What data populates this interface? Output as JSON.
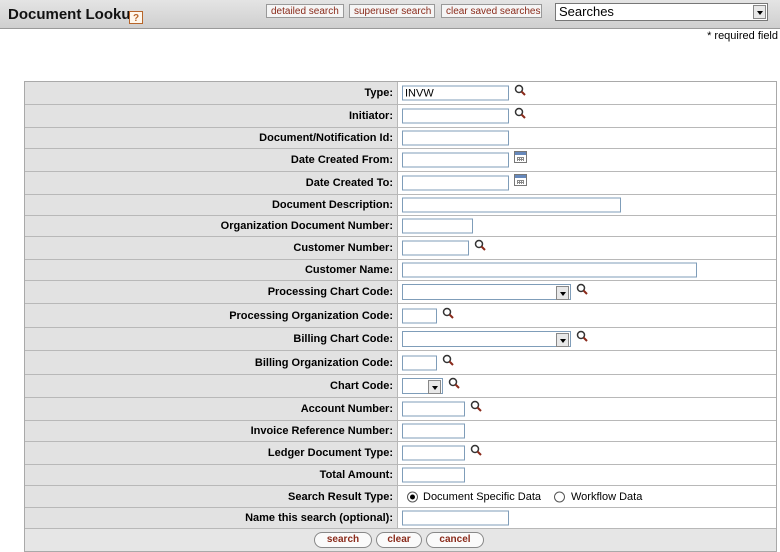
{
  "header": {
    "title": "Document Lookup",
    "help_label": "?",
    "buttons": {
      "detailed_search": "detailed search",
      "superuser_search": "superuser search",
      "clear_saved_searches": "clear saved searches"
    },
    "searches_select": "Searches"
  },
  "required_note": "* required field",
  "form": {
    "type": {
      "label": "Type:",
      "value": "INVW"
    },
    "initiator": {
      "label": "Initiator:",
      "value": ""
    },
    "document_notification_id": {
      "label": "Document/Notification Id:",
      "value": ""
    },
    "date_created_from": {
      "label": "Date Created From:",
      "value": ""
    },
    "date_created_to": {
      "label": "Date Created To:",
      "value": ""
    },
    "document_description": {
      "label": "Document Description:",
      "value": ""
    },
    "organization_document_number": {
      "label": "Organization Document Number:",
      "value": ""
    },
    "customer_number": {
      "label": "Customer Number:",
      "value": ""
    },
    "customer_name": {
      "label": "Customer Name:",
      "value": ""
    },
    "processing_chart_code": {
      "label": "Processing Chart Code:",
      "value": ""
    },
    "processing_organization_code": {
      "label": "Processing Organization Code:",
      "value": ""
    },
    "billing_chart_code": {
      "label": "Billing Chart Code:",
      "value": ""
    },
    "billing_organization_code": {
      "label": "Billing Organization Code:",
      "value": ""
    },
    "chart_code": {
      "label": "Chart Code:",
      "value": ""
    },
    "account_number": {
      "label": "Account Number:",
      "value": ""
    },
    "invoice_reference_number": {
      "label": "Invoice Reference Number:",
      "value": ""
    },
    "ledger_document_type": {
      "label": "Ledger Document Type:",
      "value": ""
    },
    "total_amount": {
      "label": "Total Amount:",
      "value": ""
    },
    "search_result_type": {
      "label": "Search Result Type:",
      "options": [
        "Document Specific Data",
        "Workflow Data"
      ],
      "selected": "Document Specific Data"
    },
    "name_this_search": {
      "label": "Name this search (optional):",
      "value": ""
    }
  },
  "actions": {
    "search": "search",
    "clear": "clear",
    "cancel": "cancel"
  },
  "icons": {
    "lookup": "magnifier-lookup-icon",
    "calendar": "calendar-icon",
    "help": "help-icon"
  }
}
